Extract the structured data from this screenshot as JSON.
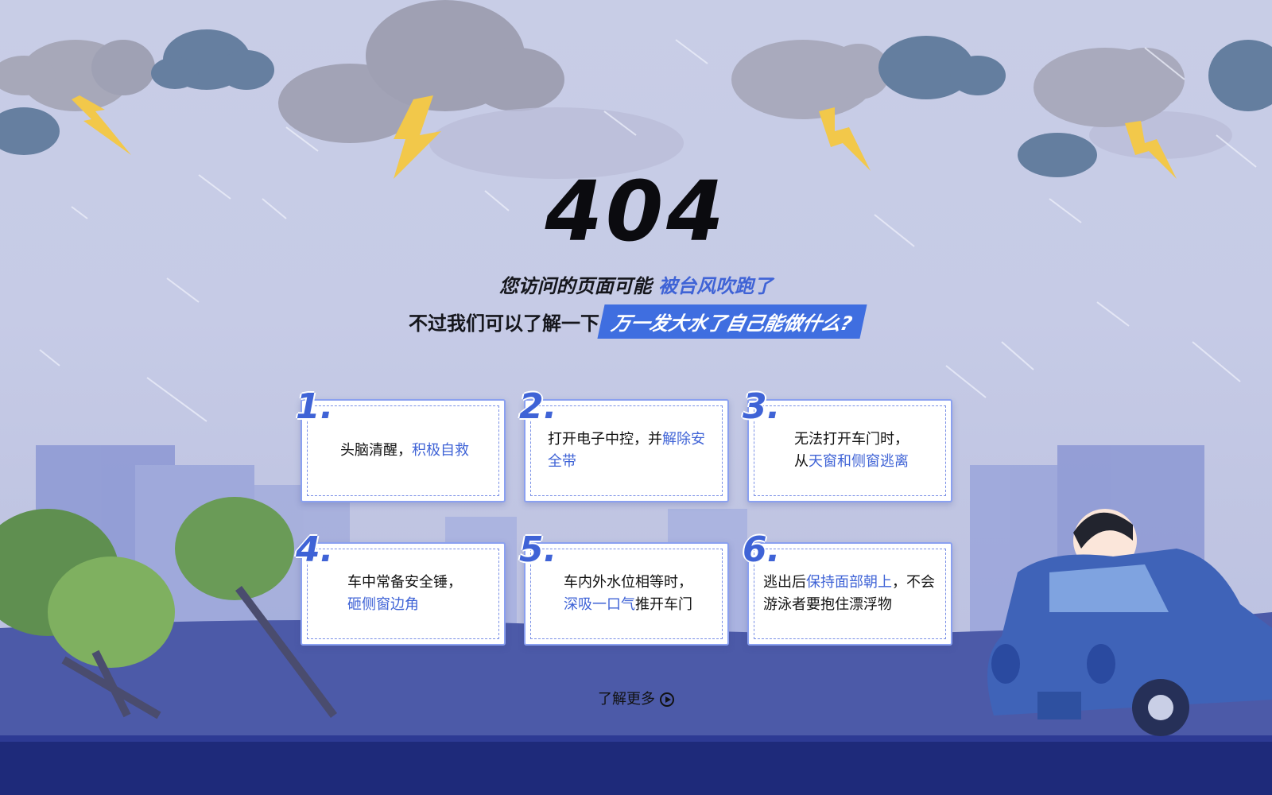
{
  "error": {
    "code": "404",
    "line1_prefix": "您访问的页面可能",
    "line1_highlight": "被台风吹跑了",
    "line2_prefix": "不过我们可以了解一下",
    "line2_tag": "万一发大水了自己能做什么?"
  },
  "tips": [
    {
      "number": "1.",
      "parts": [
        "头脑清醒，",
        "积极自救"
      ]
    },
    {
      "number": "2.",
      "parts": [
        "打开电子中控，并",
        "解除安全带"
      ]
    },
    {
      "number": "3.",
      "parts": [
        "无法打开车门时，",
        "从",
        "天窗和侧窗逃离"
      ]
    },
    {
      "number": "4.",
      "parts": [
        "车中常备安全锤，",
        "砸侧窗边角"
      ]
    },
    {
      "number": "5.",
      "parts": [
        "车内外水位相等时，",
        "深吸一口气",
        "推开车门"
      ]
    },
    {
      "number": "6.",
      "parts": [
        "逃出后",
        "保持面部朝上",
        "，不会游泳者要抱住漂浮物"
      ]
    }
  ],
  "learn_more": "了解更多",
  "colors": {
    "accent": "#3f63d6",
    "tag_bg": "#3f6ee0",
    "text": "#111111"
  }
}
